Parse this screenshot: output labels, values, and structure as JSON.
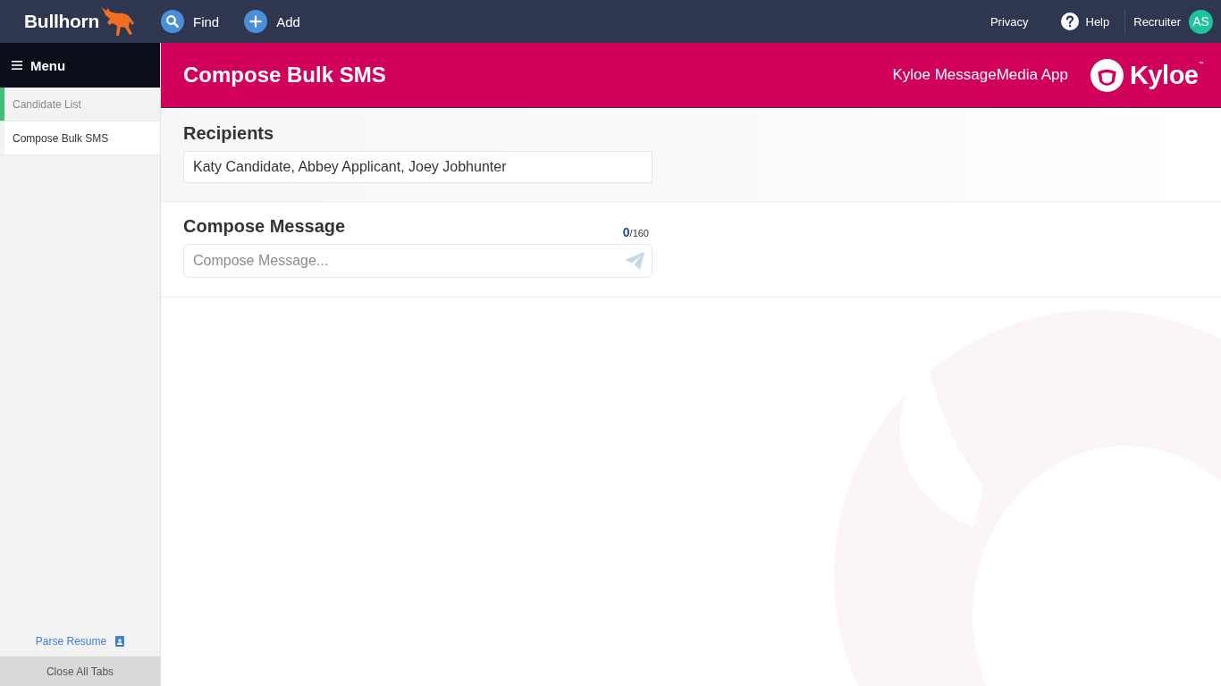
{
  "top_bar": {
    "brand": "Bullhorn",
    "actions": [
      {
        "kind": "find",
        "label": "Find"
      },
      {
        "kind": "add",
        "label": "Add"
      }
    ],
    "privacy": "Privacy",
    "help": "Help",
    "user": {
      "role": "Recruiter",
      "initials": "AS"
    }
  },
  "sidebar": {
    "menu": "Menu",
    "items": [
      {
        "label": "Candidate List",
        "selected": false,
        "color": "#3fbf7c"
      },
      {
        "label": "Compose Bulk SMS",
        "selected": true
      }
    ],
    "parse_resume": "Parse Resume",
    "close_all_tabs": "Close All Tabs"
  },
  "header": {
    "title": "Compose Bulk SMS",
    "app_name": "Kyloe MessageMedia App",
    "logo": {
      "text": "Kyloe",
      "mark": "™"
    }
  },
  "recipients": {
    "heading": "Recipients",
    "value": "Katy Candidate, Abbey Applicant, Joey Jobhunter"
  },
  "compose": {
    "heading": "Compose Message",
    "count": "0",
    "limit": "/160",
    "placeholder": "Compose Message..."
  }
}
